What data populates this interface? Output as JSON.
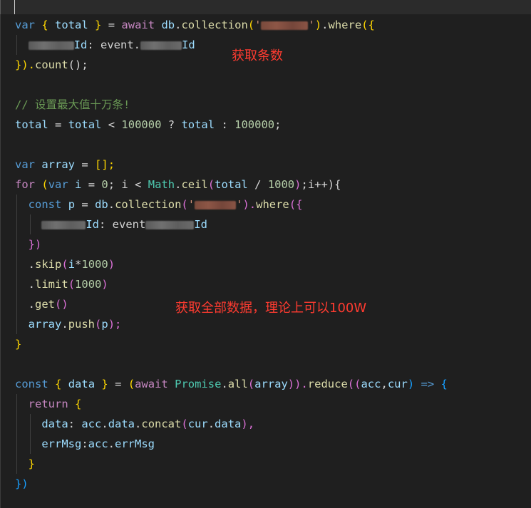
{
  "annotations": {
    "count_note": "获取条数",
    "all_data_note": "获取全部数据，理论上可以100W"
  },
  "code": {
    "line01": {
      "t1": "var",
      "t2": "{",
      "t3": "total",
      "t4": "}",
      "t5": "=",
      "t6": "await",
      "t7": "db",
      "t8": "collection",
      "t9": "'",
      "t10": "'",
      "t11": "where",
      "t12": "({"
    },
    "line02": {
      "t1": "Id",
      "t2": ": event.",
      "t3": "Id"
    },
    "line03": {
      "t1": "}).",
      "t2": "count",
      "t3": "();"
    },
    "line05": {
      "t1": "// 设置最大值十万条!"
    },
    "line06": {
      "t1": "total",
      "t2": "=",
      "t3": "total",
      "t4": "<",
      "t5": "100000",
      "t6": "?",
      "t7": "total",
      "t8": ":",
      "t9": "100000",
      "t10": ";"
    },
    "line08": {
      "t1": "var",
      "t2": "array",
      "t3": "=",
      "t4": "[];"
    },
    "line09": {
      "t1": "for",
      "t2": "(",
      "t3": "var",
      "t4": "i",
      "t5": "=",
      "t6": "0",
      "t7": "; i <",
      "t8": "Math",
      "t9": "ceil",
      "t10": "(",
      "t11": "total",
      "t12": "/",
      "t13": "1000",
      "t14": ")",
      "t15": ";i++){"
    },
    "line10": {
      "t1": "const",
      "t2": "p",
      "t3": "=",
      "t4": "db",
      "t5": "collection",
      "t6": "(",
      "t7": "'",
      "t8": "'",
      "t9": ").",
      "t10": "where",
      "t11": "({"
    },
    "line11": {
      "t1": "Id",
      "t2": ": event",
      "t3": "Id"
    },
    "line12": {
      "t1": "})"
    },
    "line13": {
      "t1": ".",
      "t2": "skip",
      "t3": "(",
      "t4": "i",
      "t5": "*",
      "t6": "1000",
      "t7": ")"
    },
    "line14": {
      "t1": ".",
      "t2": "limit",
      "t3": "(",
      "t4": "1000",
      "t5": ")"
    },
    "line15": {
      "t1": ".",
      "t2": "get",
      "t3": "()"
    },
    "line16": {
      "t1": "array",
      "t2": "push",
      "t3": "(",
      "t4": "p",
      "t5": ");"
    },
    "line17": {
      "t1": "}"
    },
    "line19": {
      "t1": "const",
      "t2": "{",
      "t3": "data",
      "t4": "}",
      "t5": "=",
      "t6": "(",
      "t7": "await",
      "t8": "Promise",
      "t9": "all",
      "t10": "(",
      "t11": "array",
      "t12": ")).",
      "t13": "reduce",
      "t14": "((",
      "t15": "acc",
      "t16": ",",
      "t17": "cur",
      "t18": ")",
      "t19": "=>",
      "t20": "{"
    },
    "line20": {
      "t1": "return",
      "t2": "{"
    },
    "line21": {
      "t1": "data",
      "t2": ":",
      "t3": "acc",
      "t4": "data",
      "t5": "concat",
      "t6": "(",
      "t7": "cur",
      "t8": "data",
      "t9": "),"
    },
    "line22": {
      "t1": "errMsg",
      "t2": ":",
      "t3": "acc",
      "t4": "errMsg"
    },
    "line23": {
      "t1": "}"
    },
    "line24": {
      "t1": "})"
    }
  }
}
